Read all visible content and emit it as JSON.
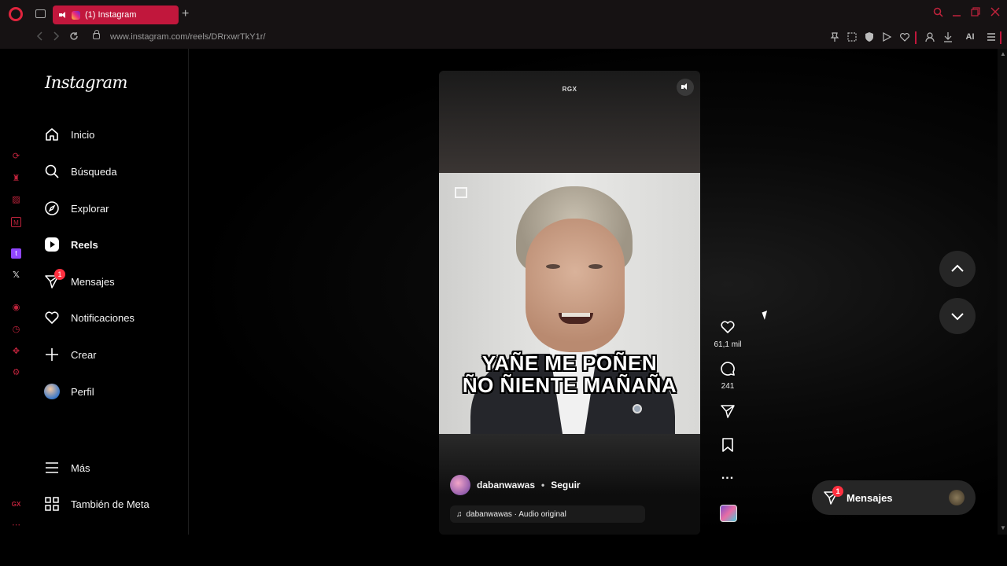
{
  "browser": {
    "tab_title": "(1) Instagram",
    "new_tab": "+",
    "url": "www.instagram.com/reels/DRrxwrTkY1r/",
    "ai_label": "AI",
    "gx_label": "GX"
  },
  "nav": {
    "logo": "Instagram",
    "items": [
      {
        "label": "Inicio",
        "icon": "home-icon"
      },
      {
        "label": "Búsqueda",
        "icon": "search-icon"
      },
      {
        "label": "Explorar",
        "icon": "compass-icon"
      },
      {
        "label": "Reels",
        "icon": "reels-icon"
      },
      {
        "label": "Mensajes",
        "icon": "messenger-icon",
        "badge": "1"
      },
      {
        "label": "Notificaciones",
        "icon": "heart-icon"
      },
      {
        "label": "Crear",
        "icon": "plus-icon"
      },
      {
        "label": "Perfil",
        "icon": "avatar"
      }
    ],
    "more": "Más",
    "meta": "También de Meta"
  },
  "reel": {
    "watermark": "RGX",
    "caption_line1": "YAÑE ME POÑEN",
    "caption_line2": "ÑO ÑIENTE MAÑAÑA",
    "author": "dabanwawas",
    "separator": "•",
    "follow": "Seguir",
    "audio": "dabanwawas · Audio original",
    "likes": "61,1 mil",
    "comments": "241",
    "more": "..."
  },
  "messages_pill": {
    "label": "Mensajes",
    "badge": "1"
  },
  "colors": {
    "accent": "#c1173c",
    "badge": "#ff3040",
    "background": "#000000"
  }
}
